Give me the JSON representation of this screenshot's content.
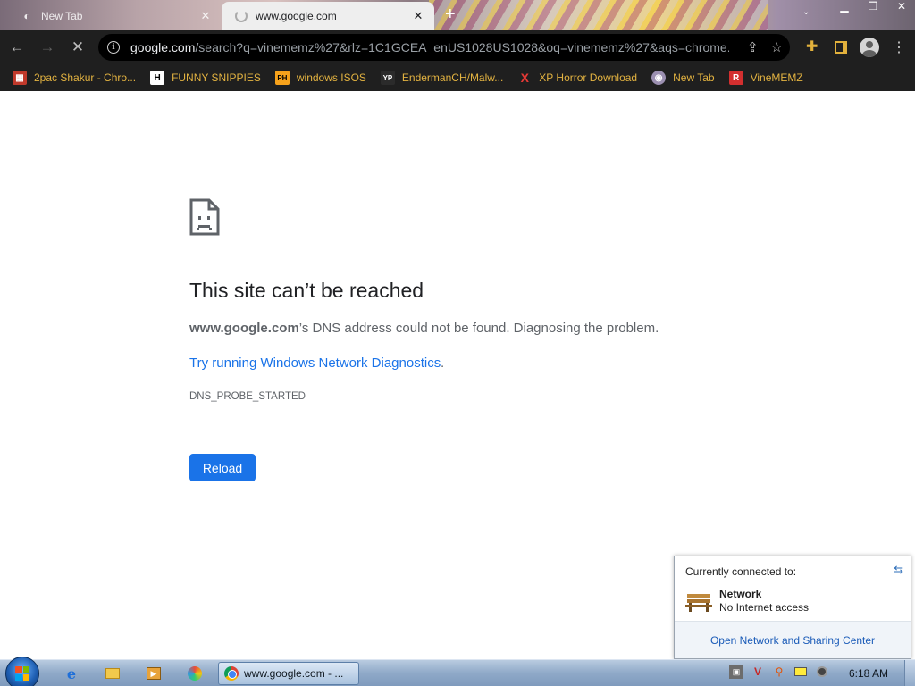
{
  "browser": {
    "tabs": [
      {
        "title": "New Tab",
        "active": false,
        "icon": "chrome-newtab-icon"
      },
      {
        "title": "www.google.com",
        "active": true,
        "icon": "loading-spinner-icon"
      }
    ],
    "new_tab_label": "+",
    "url_host": "google.com",
    "url_rest": "/search?q=vinememz%27&rlz=1C1GCEA_enUS1028US1028&oq=vinememz%27&aqs=chrome....",
    "bookmarks": [
      {
        "label": "2pac Shakur - Chro...",
        "icon": "gift-icon"
      },
      {
        "label": "FUNNY SNIPPIES",
        "icon": "H"
      },
      {
        "label": "windows ISOS",
        "icon": "PH"
      },
      {
        "label": "EndermanCH/Malw...",
        "icon": "YP"
      },
      {
        "label": "XP Horror Download",
        "icon": "X"
      },
      {
        "label": "New Tab",
        "icon": "globe-icon"
      },
      {
        "label": "VineMEMZ",
        "icon": "R"
      }
    ]
  },
  "error_page": {
    "title": "This site can’t be reached",
    "host": "www.google.com",
    "description_suffix": "’s DNS address could not be found. Diagnosing the problem.",
    "diagnostics_link": "Try running Windows Network Diagnostics",
    "diagnostics_period": ".",
    "error_code": "DNS_PROBE_STARTED",
    "reload_label": "Reload"
  },
  "network_popup": {
    "header": "Currently connected to:",
    "network_name": "Network",
    "network_status": "No Internet access",
    "footer_link": "Open Network and Sharing Center"
  },
  "taskbar": {
    "chrome_window_label": "www.google.com - ...",
    "clock": "6:18 AM"
  },
  "colors": {
    "accent_blue": "#1a73e8",
    "bookmark_text": "#e3b341",
    "toolbar_bg": "#1f1f1f"
  }
}
